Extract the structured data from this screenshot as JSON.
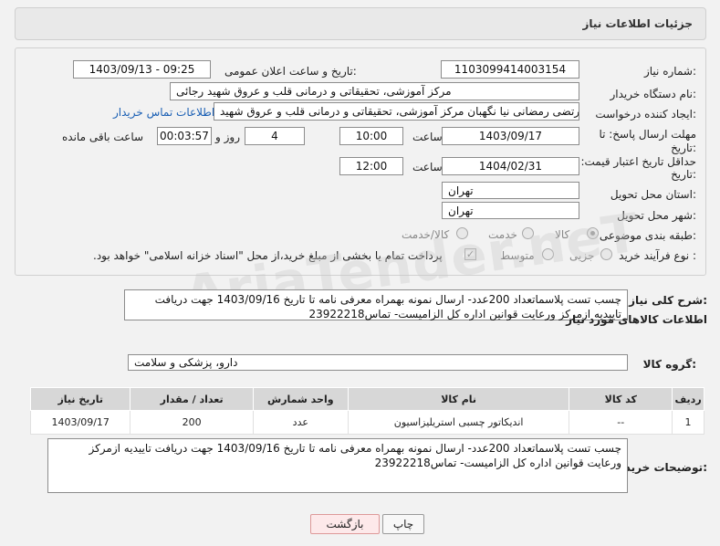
{
  "header": {
    "title": "جزئیات اطلاعات نیاز"
  },
  "fields": {
    "need_number": {
      "label": "شماره نیاز:",
      "value": "1103099414003154"
    },
    "announce_datetime": {
      "label": "تاریخ و ساعت اعلان عمومی:",
      "value": "1403/09/13 - 09:25"
    },
    "buyer_org": {
      "label": "نام دستگاه خریدار:",
      "value": "مرکز آموزشی، تحقیقاتی و درمانی قلب و عروق شهید رجائی"
    },
    "requester": {
      "label": "ایجاد کننده درخواست:",
      "value": "مرتضی رمضانی نیا نگهبان مرکز آموزشی، تحقیقاتی و درمانی قلب و عروق شهید",
      "link": "اطلاعات تماس خریدار"
    },
    "reply_deadline": {
      "label": "مهلت ارسال پاسخ: تا",
      "label2": "تاریخ:",
      "date": "1403/09/17",
      "time_label": "ساعت",
      "time": "10:00",
      "days": "4",
      "days_label": "روز و",
      "remaining": "00:03:57",
      "remaining_label": "ساعت باقی مانده"
    },
    "price_validity": {
      "label": "حداقل تاریخ اعتبار قیمت: تا",
      "label2": "تاریخ:",
      "date": "1404/02/31",
      "time_label": "ساعت",
      "time": "12:00"
    },
    "province": {
      "label": "استان محل تحویل:",
      "value": "تهران"
    },
    "city": {
      "label": "شهر محل تحویل:",
      "value": "تهران"
    },
    "category": {
      "label": "طبقه بندی موضوعی:",
      "options": [
        "کالا",
        "خدمت",
        "کالا/خدمت"
      ],
      "selected": "کالا"
    },
    "purchase_type": {
      "label": "نوع فرآیند خرید :",
      "options": [
        "جزیی",
        "متوسط"
      ],
      "checkbox_text": "پرداخت تمام یا بخشی از مبلغ خرید،از محل \"اسناد خزانه اسلامی\" خواهد بود."
    }
  },
  "general_description": {
    "label": "شرح کلی نیاز:",
    "value": "چسب تست پلاسماتعداد 200عدد- ارسال نمونه بهمراه معرفی نامه تا تاریخ 1403/09/16 جهت دریافت تاییدیه ازمرکز ورعایت قوانین اداره کل الزامیست- تماس23922218"
  },
  "goods_section": {
    "title": "اطلاعات کالاهای مورد نیاز",
    "group_label": "گروه کالا:",
    "group_value": "دارو، پزشکی و سلامت"
  },
  "table": {
    "headers": [
      "ردیف",
      "کد کالا",
      "نام کالا",
      "واحد شمارش",
      "تعداد / مقدار",
      "تاریخ نیاز"
    ],
    "rows": [
      [
        "1",
        "--",
        "اندیکاتور چسبی استریلیزاسیون",
        "عدد",
        "200",
        "1403/09/17"
      ]
    ]
  },
  "buyer_notes": {
    "label": "توضیحات خریدار:",
    "value": "چسب تست پلاسماتعداد 200عدد- ارسال نمونه بهمراه معرفی نامه تا تاریخ 1403/09/16 جهت دریافت تاییدیه ازمرکز ورعایت قوانین اداره کل الزامیست- تماس23922218"
  },
  "buttons": {
    "print": "چاپ",
    "back": "بازگشت"
  }
}
